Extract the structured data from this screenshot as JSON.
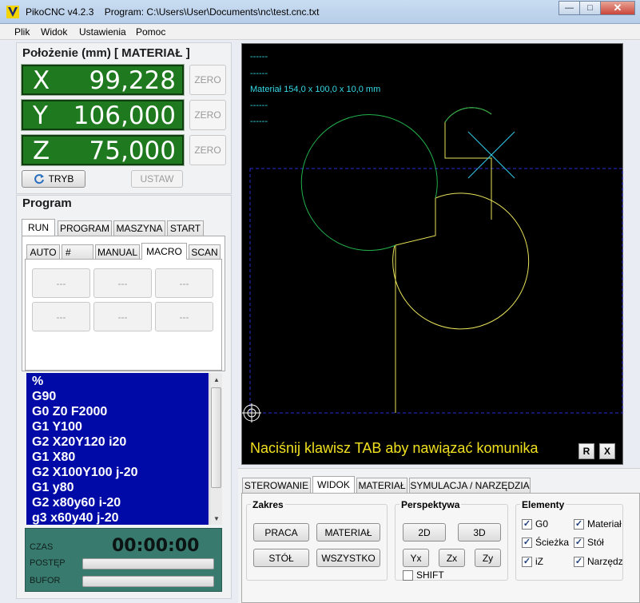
{
  "titlebar": {
    "app_name": "PikoCNC v4.2.3",
    "program_label": "Program: C:\\Users\\User\\Documents\\nc\\test.cnc.txt",
    "minimize": "—",
    "maximize": "□",
    "close": "✕"
  },
  "menu": [
    "Plik",
    "Widok",
    "Ustawienia",
    "Pomoc"
  ],
  "position": {
    "title": "Położenie (mm) [ MATERIAŁ ]",
    "axes": [
      {
        "letter": "X",
        "value": "99,228",
        "zero": "ZERO"
      },
      {
        "letter": "Y",
        "value": "106,000",
        "zero": "ZERO"
      },
      {
        "letter": "Z",
        "value": "75,000",
        "zero": "ZERO"
      }
    ],
    "mode_button": "TRYB",
    "set_button": "USTAW"
  },
  "program": {
    "title": "Program",
    "main_tabs": [
      "RUN",
      "PROGRAM",
      "MASZYNA",
      "START"
    ],
    "sub_tabs": [
      "AUTO",
      "#",
      "MANUAL",
      "MACRO",
      "SCAN"
    ],
    "macros": [
      "---",
      "---",
      "---",
      "---",
      "---",
      "---"
    ],
    "gcode": [
      "%",
      "G90",
      "G0 Z0 F2000",
      "G1 Y100",
      "G2 X20Y120 i20",
      "G1 X80",
      "G2 X100Y100 j-20",
      "G1 y80",
      "G2 x80y60 i-20",
      "g3 x60y40 j-20"
    ]
  },
  "status": {
    "time_label": "CZAS",
    "time_value": "00:00:00",
    "progress_label": "POSTĘP",
    "buffer_label": "BUFOR"
  },
  "viewport": {
    "info": [
      "------",
      "------",
      "Materiał 154,0 x 100,0 x 10,0 mm",
      "------",
      "------"
    ],
    "message": "Naciśnij klawisz TAB aby nawiązać komunika",
    "btn_r": "R",
    "btn_x": "X",
    "colors": {
      "background": "#000000",
      "path": "#22b14c",
      "tool": "#e9e25a",
      "info": "#35d9e6",
      "material": "#2b2bd6"
    }
  },
  "bottom": {
    "tabs": [
      "STEROWANIE",
      "WIDOK",
      "MATERIAŁ",
      "SYMULACJA / NARZĘDZIA"
    ],
    "zakres": {
      "title": "Zakres",
      "buttons": [
        "PRACA",
        "MATERIAŁ",
        "STÓŁ",
        "WSZYSTKO"
      ]
    },
    "perspektywa": {
      "title": "Perspektywa",
      "buttons": [
        "2D",
        "3D",
        "Yx",
        "Zx",
        "Zy"
      ],
      "shift": "SHIFT"
    },
    "elementy": {
      "title": "Elementy",
      "items": [
        "G0",
        "Materiał",
        "Ścieżka",
        "Stół",
        "iZ",
        "Narzędz"
      ]
    }
  }
}
